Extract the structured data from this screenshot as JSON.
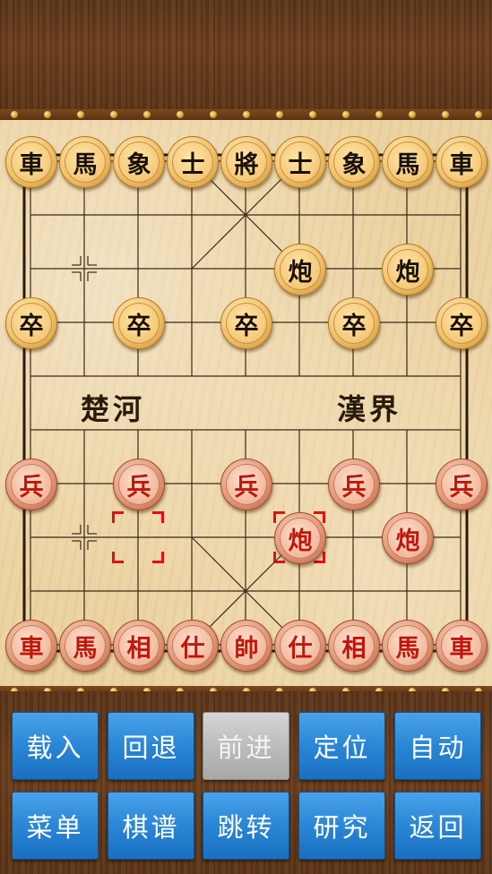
{
  "river": {
    "left": "楚河",
    "right": "漢界"
  },
  "colors": {
    "black_text": "#1a1008",
    "red_text": "#c0160c",
    "marker": "#e01010",
    "button": "#2a86d6"
  },
  "pieces": [
    {
      "label": "車",
      "side": "black"
    },
    {
      "label": "馬",
      "side": "black"
    },
    {
      "label": "象",
      "side": "black"
    },
    {
      "label": "士",
      "side": "black"
    },
    {
      "label": "將",
      "side": "black"
    },
    {
      "label": "士",
      "side": "black"
    },
    {
      "label": "象",
      "side": "black"
    },
    {
      "label": "馬",
      "side": "black"
    },
    {
      "label": "車",
      "side": "black"
    },
    {
      "label": "炮",
      "side": "black"
    },
    {
      "label": "炮",
      "side": "black"
    },
    {
      "label": "卒",
      "side": "black"
    },
    {
      "label": "卒",
      "side": "black"
    },
    {
      "label": "卒",
      "side": "black"
    },
    {
      "label": "卒",
      "side": "black"
    },
    {
      "label": "卒",
      "side": "black"
    },
    {
      "label": "兵",
      "side": "red"
    },
    {
      "label": "兵",
      "side": "red"
    },
    {
      "label": "兵",
      "side": "red"
    },
    {
      "label": "兵",
      "side": "red"
    },
    {
      "label": "兵",
      "side": "red"
    },
    {
      "label": "炮",
      "side": "red"
    },
    {
      "label": "炮",
      "side": "red"
    },
    {
      "label": "車",
      "side": "red"
    },
    {
      "label": "馬",
      "side": "red"
    },
    {
      "label": "相",
      "side": "red"
    },
    {
      "label": "仕",
      "side": "red"
    },
    {
      "label": "帥",
      "side": "red"
    },
    {
      "label": "仕",
      "side": "red"
    },
    {
      "label": "相",
      "side": "red"
    },
    {
      "label": "馬",
      "side": "red"
    },
    {
      "label": "車",
      "side": "red"
    }
  ],
  "buttons": {
    "row1": [
      "载入",
      "回退",
      "前进",
      "定位",
      "自动"
    ],
    "row2": [
      "菜单",
      "棋谱",
      "跳转",
      "研究",
      "返回"
    ]
  }
}
